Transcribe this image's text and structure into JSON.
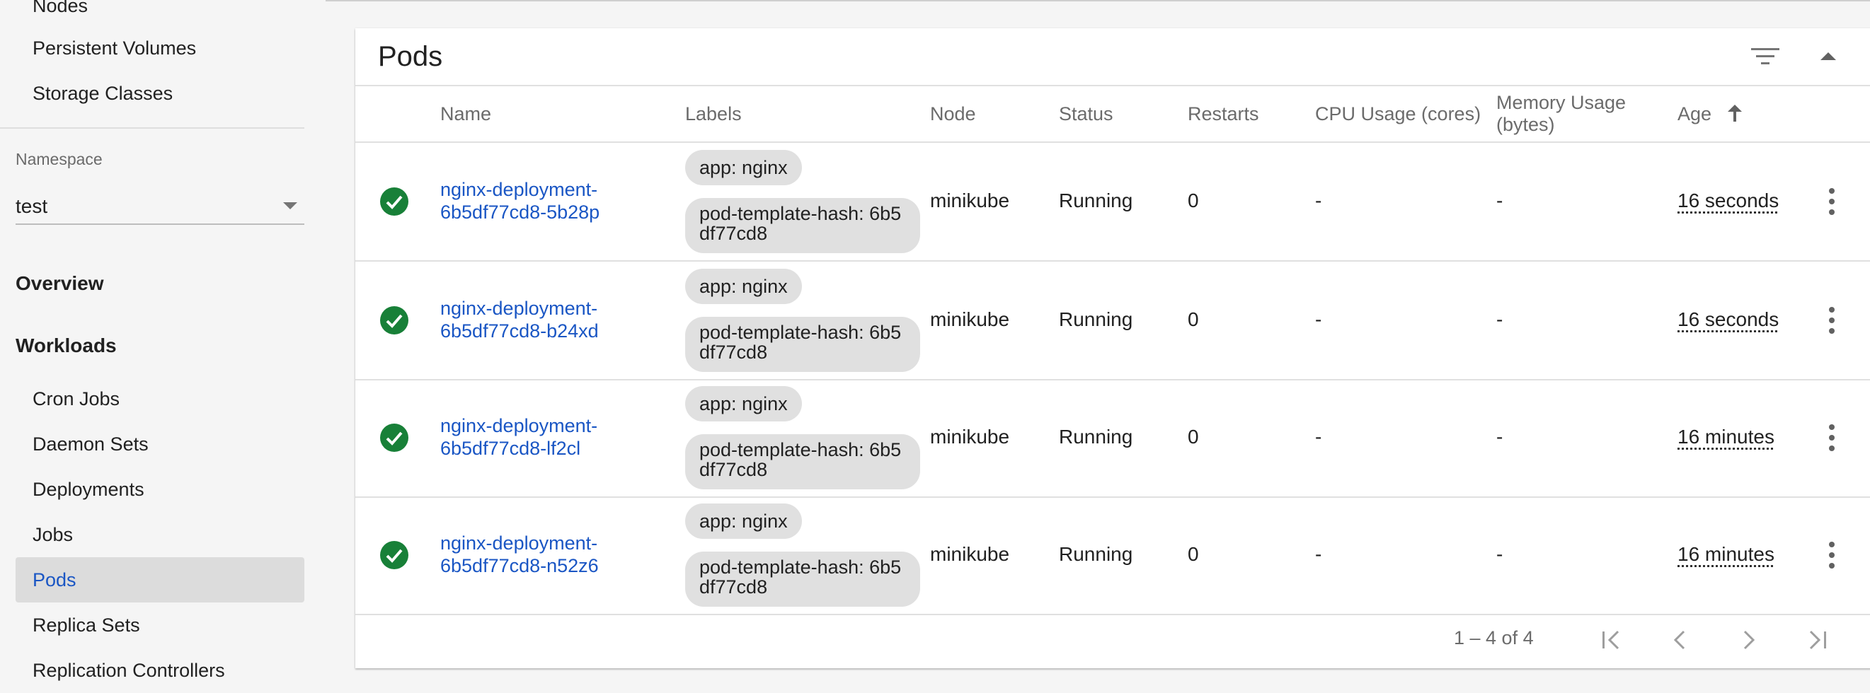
{
  "sidebar": {
    "items_top": [
      "Nodes",
      "Persistent Volumes",
      "Storage Classes"
    ],
    "namespace_label": "Namespace",
    "namespace_value": "test",
    "overview": "Overview",
    "workloads": "Workloads",
    "workload_items": [
      "Cron Jobs",
      "Daemon Sets",
      "Deployments",
      "Jobs",
      "Pods",
      "Replica Sets",
      "Replication Controllers"
    ],
    "active_item": "Pods"
  },
  "card": {
    "title": "Pods",
    "columns": {
      "name": "Name",
      "labels": "Labels",
      "node": "Node",
      "status": "Status",
      "restarts": "Restarts",
      "cpu": "CPU Usage (cores)",
      "memory": "Memory Usage (bytes)",
      "age": "Age"
    },
    "rows": [
      {
        "name_line1": "nginx-deployment-",
        "name_line2": "6b5df77cd8-5b28p",
        "label1": "app: nginx",
        "label2": "pod-template-hash: 6b5df77cd8",
        "node": "minikube",
        "status": "Running",
        "restarts": "0",
        "cpu": "-",
        "memory": "-",
        "age": "16 seconds"
      },
      {
        "name_line1": "nginx-deployment-",
        "name_line2": "6b5df77cd8-b24xd",
        "label1": "app: nginx",
        "label2": "pod-template-hash: 6b5df77cd8",
        "node": "minikube",
        "status": "Running",
        "restarts": "0",
        "cpu": "-",
        "memory": "-",
        "age": "16 seconds"
      },
      {
        "name_line1": "nginx-deployment-",
        "name_line2": "6b5df77cd8-lf2cl",
        "label1": "app: nginx",
        "label2": "pod-template-hash: 6b5df77cd8",
        "node": "minikube",
        "status": "Running",
        "restarts": "0",
        "cpu": "-",
        "memory": "-",
        "age": "16 minutes"
      },
      {
        "name_line1": "nginx-deployment-",
        "name_line2": "6b5df77cd8-n52z6",
        "label1": "app: nginx",
        "label2": "pod-template-hash: 6b5df77cd8",
        "node": "minikube",
        "status": "Running",
        "restarts": "0",
        "cpu": "-",
        "memory": "-",
        "age": "16 minutes"
      }
    ],
    "pagination": "1 – 4 of 4"
  },
  "icons": {
    "status": "check-circle-icon",
    "sort": "arrow-up-icon",
    "filter": "filter-icon",
    "collapse": "caret-up-icon",
    "more": "more-vert-icon",
    "pagination": [
      "first-page-icon",
      "prev-page-icon",
      "next-page-icon",
      "last-page-icon"
    ]
  },
  "colors": {
    "accent": "#1a56c4",
    "success": "#188038",
    "active_nav_bg": "#dcdcdc"
  }
}
